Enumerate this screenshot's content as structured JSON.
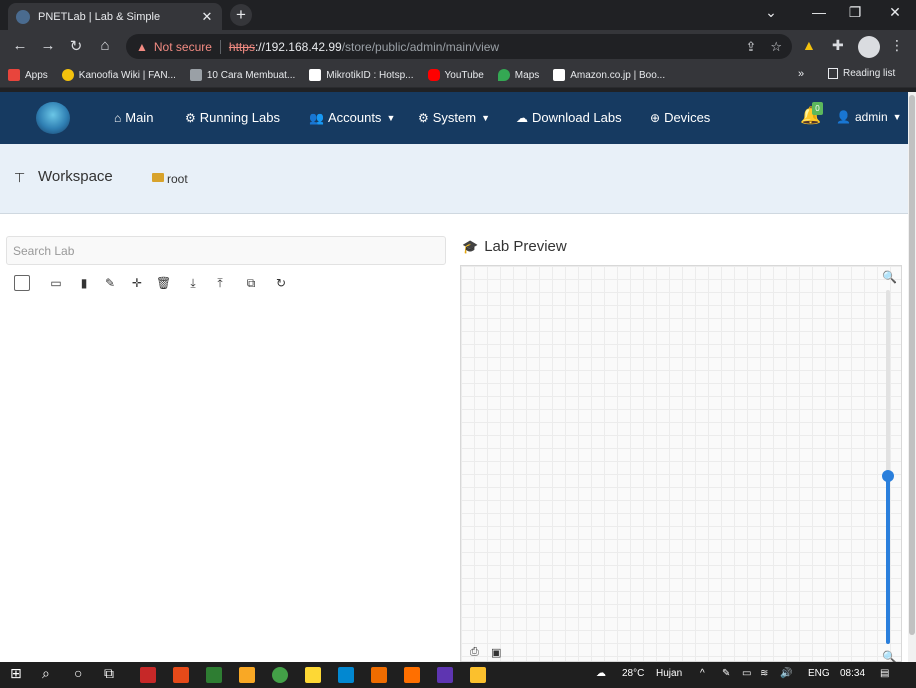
{
  "browser": {
    "tab_title": "PNETLab | Lab & Simple",
    "tab_close": "✕",
    "new_tab": "+",
    "window_controls": {
      "minimize": "⌄",
      "restore": "—",
      "maximize": "❐",
      "close": "✕"
    },
    "nav": {
      "back": "←",
      "forward": "→",
      "reload": "↻",
      "home": "⌂"
    },
    "address": {
      "security_warning": "Not secure",
      "scheme": "https",
      "host": "://192.168.42.99",
      "path": "/store/public/admin/main/view"
    },
    "bookmarks": [
      {
        "label": "Apps",
        "color": "#e8453c"
      },
      {
        "label": "Kanoofia Wiki | FAN...",
        "color": "#f4c20d"
      },
      {
        "label": "10 Cara Membuat...",
        "color": "#9aa0a6"
      },
      {
        "label": "MikrotikID : Hotsp...",
        "color": "#ffffff"
      },
      {
        "label": "YouTube",
        "color": "#ff0000"
      },
      {
        "label": "Maps",
        "color": "#34a853"
      },
      {
        "label": "Amazon.co.jp | Boo...",
        "color": "#ffffff"
      }
    ],
    "bookmarks_more": "»",
    "reading_list": "Reading list"
  },
  "app": {
    "nav": {
      "main": "Main",
      "running_labs": "Running Labs",
      "accounts": "Accounts",
      "system": "System",
      "download_labs": "Download Labs",
      "devices": "Devices",
      "notification_count": "0",
      "user": "admin"
    },
    "workspace": {
      "title": "Workspace",
      "folder": "root"
    },
    "search_placeholder": "Search Lab",
    "preview_title": "Lab Preview"
  },
  "taskbar": {
    "weather": "28°C",
    "weather_label": "Hujan",
    "language": "ENG",
    "time": "08:34"
  },
  "colors": {
    "navbar": "#163a61",
    "workspace_bg": "#e8f0f8",
    "accent": "#2a7fdc",
    "warning": "#f28b82"
  }
}
